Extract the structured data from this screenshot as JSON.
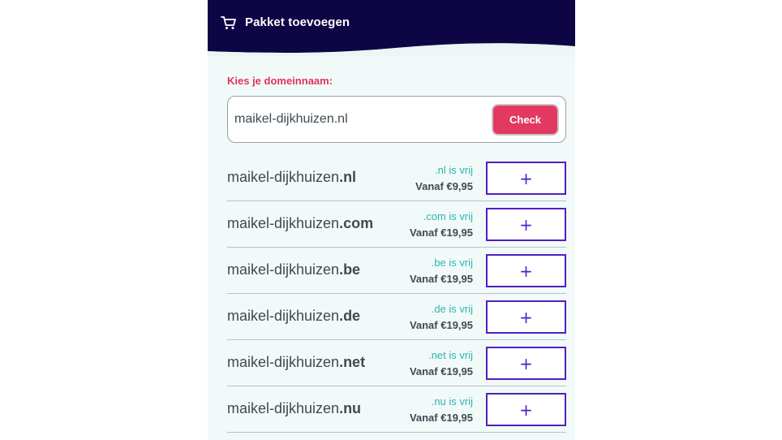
{
  "header": {
    "title": "Pakket toevoegen",
    "icon": "cart-icon",
    "background_color": "#0e0545"
  },
  "domain_search": {
    "label": "Kies je domeinnaam:",
    "value": "maikel-dijkhuizen.nl",
    "button_label": "Check",
    "button_color": "#e33960"
  },
  "domains": [
    {
      "base": "maikel-dijkhuizen",
      "ext": ".nl",
      "status": ".nl is vrij",
      "price": "Vanaf €9,95",
      "add_label": "+"
    },
    {
      "base": "maikel-dijkhuizen",
      "ext": ".com",
      "status": ".com is vrij",
      "price": "Vanaf €19,95",
      "add_label": "+"
    },
    {
      "base": "maikel-dijkhuizen",
      "ext": ".be",
      "status": ".be is vrij",
      "price": "Vanaf €19,95",
      "add_label": "+"
    },
    {
      "base": "maikel-dijkhuizen",
      "ext": ".de",
      "status": ".de is vrij",
      "price": "Vanaf €19,95",
      "add_label": "+"
    },
    {
      "base": "maikel-dijkhuizen",
      "ext": ".net",
      "status": ".net is vrij",
      "price": "Vanaf €19,95",
      "add_label": "+"
    },
    {
      "base": "maikel-dijkhuizen",
      "ext": ".nu",
      "status": ".nu is vrij",
      "price": "Vanaf €19,95",
      "add_label": "+"
    }
  ],
  "colors": {
    "accent": "#4f1fc2",
    "available": "#2fb3b0",
    "label": "#e0335d"
  }
}
